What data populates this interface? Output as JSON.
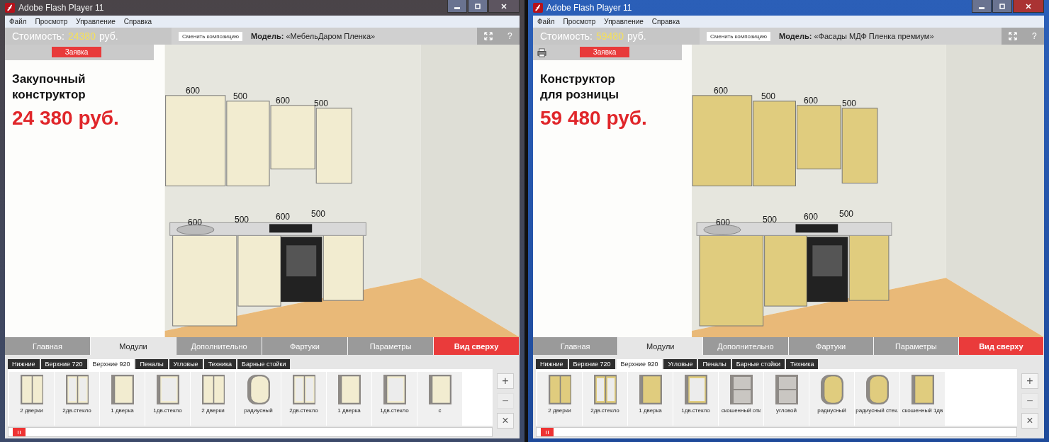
{
  "windows": [
    {
      "title": "Adobe Flash Player 11",
      "active": false,
      "color": "#f2ecd0",
      "printer": false,
      "menu": [
        "Файл",
        "Просмотр",
        "Управление",
        "Справка"
      ],
      "cost_label": "Стоимость:",
      "cost_value": "24380",
      "cost_unit": "руб.",
      "change_button": "Сменить композицию",
      "model": "**Модель:** «МебельДаром Пленка»",
      "help": "?",
      "order_button": "Заявка",
      "heading": "Закупочный\nконструктор",
      "price": "24 380 руб.",
      "dimensions_upper": [
        "600",
        "500",
        "600",
        "500"
      ],
      "dimensions_lower": [
        "600",
        "500",
        "600",
        "500"
      ],
      "tabs": [
        {
          "label": "Главная",
          "selected": false,
          "kind": "tab"
        },
        {
          "label": "Модули",
          "selected": true,
          "kind": "tab"
        },
        {
          "label": "Дополнительно",
          "selected": false,
          "kind": "tab"
        },
        {
          "label": "Фартуки",
          "selected": false,
          "kind": "tab"
        },
        {
          "label": "Параметры",
          "selected": false,
          "kind": "tab"
        },
        {
          "label": "Вид сверху",
          "selected": false,
          "kind": "action"
        }
      ],
      "subtabs": [
        {
          "label": "Нижние",
          "selected": false
        },
        {
          "label": "Верхние 720",
          "selected": false
        },
        {
          "label": "Верхние 920",
          "selected": true
        },
        {
          "label": "Пеналы",
          "selected": false
        },
        {
          "label": "Угловые",
          "selected": false
        },
        {
          "label": "Техника",
          "selected": false
        },
        {
          "label": "Барные стойки",
          "selected": false
        }
      ],
      "modules": [
        {
          "label": "2 дверки",
          "kind": "double"
        },
        {
          "label": "2дв.стекло",
          "kind": "double-glass"
        },
        {
          "label": "1 дверка",
          "kind": "single"
        },
        {
          "label": "1дв.стекло",
          "kind": "single-glass"
        },
        {
          "label": "2 дверки",
          "kind": "double"
        },
        {
          "label": "радиусный",
          "kind": "rounded"
        },
        {
          "label": "2дв.стекло",
          "kind": "double-glass"
        },
        {
          "label": "1 дверка",
          "kind": "single"
        },
        {
          "label": "1дв.стекло",
          "kind": "single-glass"
        },
        {
          "label": "с",
          "kind": "single"
        }
      ],
      "side_buttons": [
        {
          "label": "+",
          "disabled": false
        },
        {
          "label": "−",
          "disabled": true
        },
        {
          "label": "×",
          "disabled": false
        }
      ]
    },
    {
      "title": "Adobe Flash Player 11",
      "active": true,
      "color": "#e0cc7e",
      "printer": true,
      "menu": [
        "Файл",
        "Просмотр",
        "Управление",
        "Справка"
      ],
      "cost_label": "Стоимость:",
      "cost_value": "59480",
      "cost_unit": "руб.",
      "change_button": "Сменить композицию",
      "model": "**Модель:** «Фасады МДФ Пленка премиум»",
      "help": "?",
      "order_button": "Заявка",
      "heading": "Конструктор\nдля розницы",
      "price": "59 480 руб.",
      "dimensions_upper": [
        "600",
        "500",
        "600",
        "500"
      ],
      "dimensions_lower": [
        "600",
        "500",
        "600",
        "500"
      ],
      "tabs": [
        {
          "label": "Главная",
          "selected": false,
          "kind": "tab"
        },
        {
          "label": "Модули",
          "selected": true,
          "kind": "tab"
        },
        {
          "label": "Дополнительно",
          "selected": false,
          "kind": "tab"
        },
        {
          "label": "Фартуки",
          "selected": false,
          "kind": "tab"
        },
        {
          "label": "Параметры",
          "selected": false,
          "kind": "tab"
        },
        {
          "label": "Вид сверху",
          "selected": false,
          "kind": "action"
        }
      ],
      "subtabs": [
        {
          "label": "Нижние",
          "selected": false
        },
        {
          "label": "Верхние 720",
          "selected": false
        },
        {
          "label": "Верхние 920",
          "selected": true
        },
        {
          "label": "Угловые",
          "selected": false
        },
        {
          "label": "Пеналы",
          "selected": false
        },
        {
          "label": "Барные стойки",
          "selected": false
        },
        {
          "label": "Техника",
          "selected": false
        }
      ],
      "modules": [
        {
          "label": "2 дверки",
          "kind": "double"
        },
        {
          "label": "2дв.стекло",
          "kind": "double-glass"
        },
        {
          "label": "1 дверка",
          "kind": "single"
        },
        {
          "label": "1дв.стекло",
          "kind": "single-glass"
        },
        {
          "label": "скошенный отк",
          "kind": "open"
        },
        {
          "label": "угловой",
          "kind": "open"
        },
        {
          "label": "радиусный",
          "kind": "rounded"
        },
        {
          "label": "радиусный стек.",
          "kind": "rounded"
        },
        {
          "label": "скошенный 1дв",
          "kind": "single"
        }
      ],
      "side_buttons": [
        {
          "label": "+",
          "disabled": false
        },
        {
          "label": "−",
          "disabled": true
        },
        {
          "label": "×",
          "disabled": false
        }
      ]
    }
  ]
}
